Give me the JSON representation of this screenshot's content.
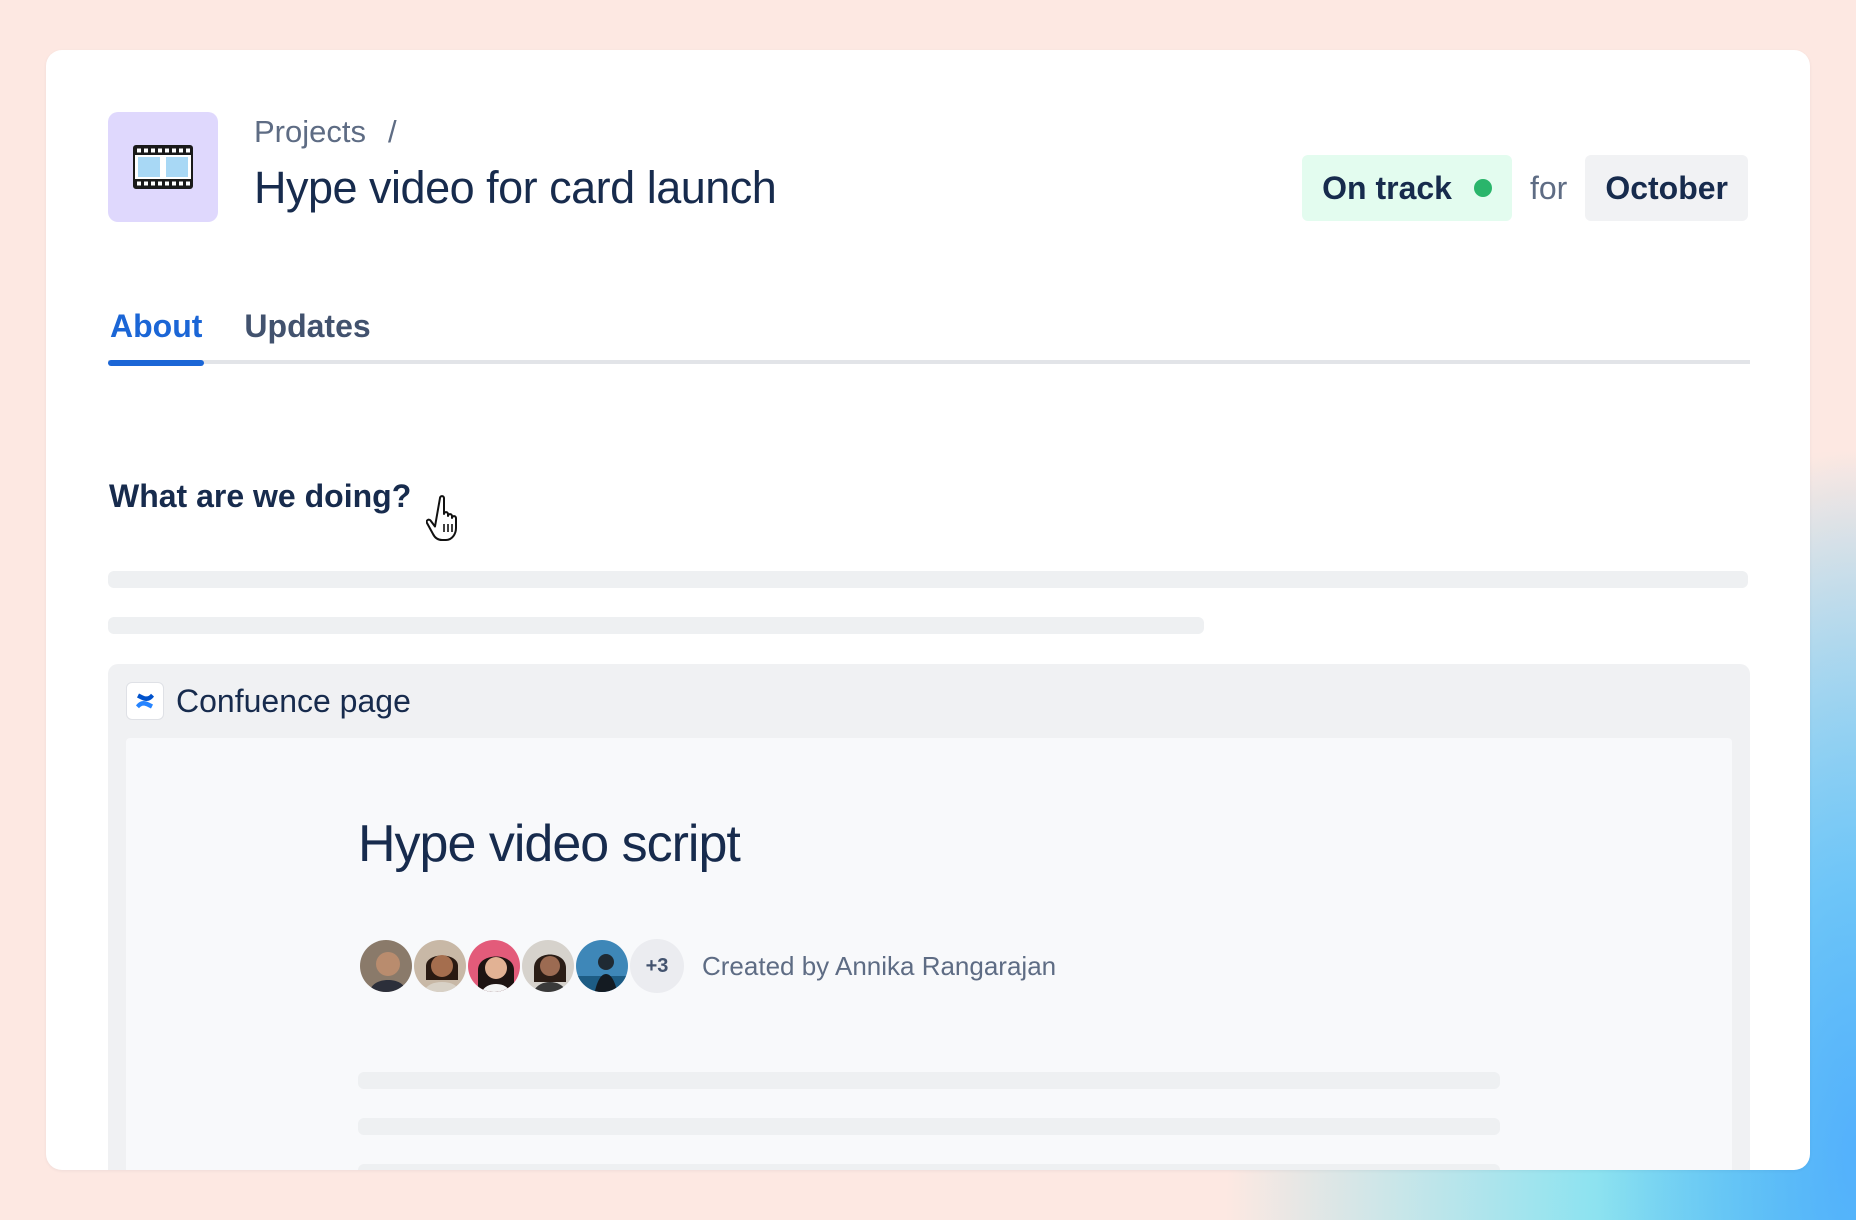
{
  "breadcrumb": {
    "parent": "Projects",
    "separator": "/"
  },
  "project": {
    "icon": "film-strip-icon",
    "title": "Hype video for card launch"
  },
  "status": {
    "label": "On track",
    "color": "#2ab56b",
    "connector": "for",
    "target": "October"
  },
  "tabs": [
    {
      "label": "About",
      "active": true
    },
    {
      "label": "Updates",
      "active": false
    }
  ],
  "about": {
    "heading": "What are we doing?"
  },
  "embed": {
    "source_icon": "confluence-icon",
    "source_label": "Confuence page",
    "document": {
      "title": "Hype video script",
      "contributors_more": "+3",
      "created_by": "Created by Annika Rangarajan"
    }
  },
  "colors": {
    "accent": "#1b66d6",
    "text": "#172b4d",
    "status_bg": "#e3fcef",
    "icon_bg": "#dfd8fd"
  }
}
